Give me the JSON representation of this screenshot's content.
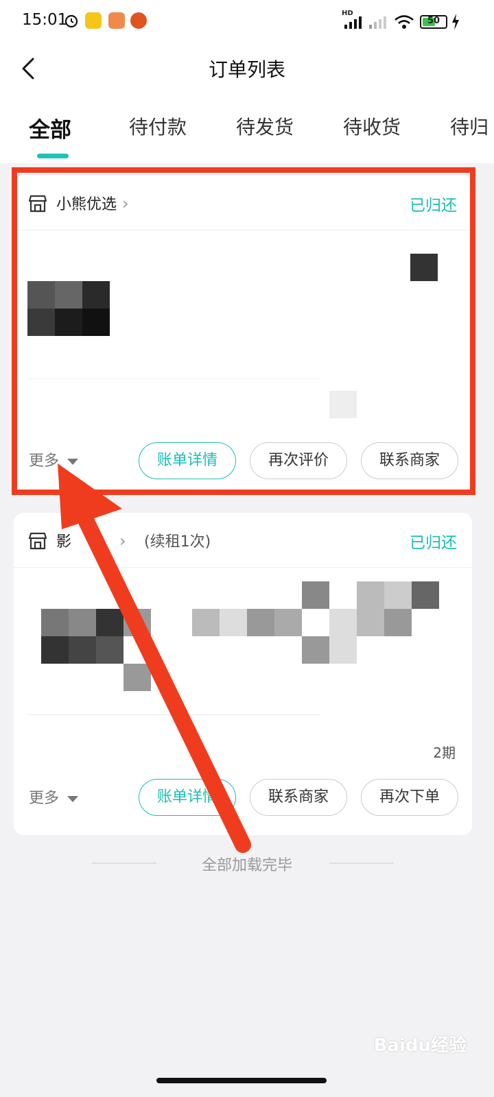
{
  "status_bar": {
    "time": "15:01",
    "battery": "50",
    "network_badge": "HD"
  },
  "header": {
    "title": "订单列表"
  },
  "tabs": [
    {
      "label": "全部",
      "active": true
    },
    {
      "label": "待付款",
      "active": false
    },
    {
      "label": "待发货",
      "active": false
    },
    {
      "label": "待收货",
      "active": false
    },
    {
      "label": "待归",
      "active": false
    }
  ],
  "orders": [
    {
      "store": "小熊优选",
      "status": "已归还",
      "more_label": "更多",
      "actions": [
        "账单详情",
        "再次评价",
        "联系商家"
      ]
    },
    {
      "store": "影",
      "renew_note": "(续租1次)",
      "status": "已归还",
      "period_note": "2期",
      "more_label": "更多",
      "actions": [
        "账单详情",
        "联系商家",
        "再次下单"
      ]
    }
  ],
  "footer": {
    "end_text": "全部加载完毕"
  },
  "watermark": "Baidu经验",
  "colors": {
    "accent": "#18bfb3",
    "annotation": "#f03c1e",
    "background": "#f2f2f4"
  }
}
